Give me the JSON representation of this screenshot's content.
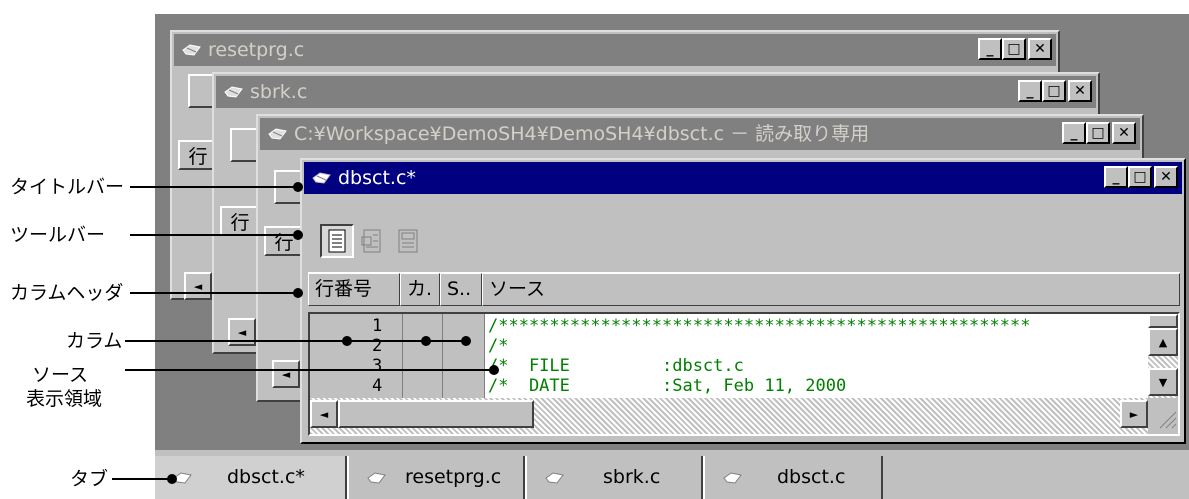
{
  "windows": {
    "resetprg": {
      "title": "resetprg.c"
    },
    "sbrk": {
      "title": "sbrk.c"
    },
    "dbsct_ro": {
      "title": "C:¥Workspace¥DemoSH4¥DemoSH4¥dbsct.c － 読み取り専用"
    },
    "dbsct_active": {
      "title": "dbsct.c*"
    },
    "back_col_label": "行",
    "min_glyph": "_",
    "max_glyph": "□",
    "close_glyph": "✕"
  },
  "columns": {
    "headers": [
      "行番号",
      "カ.",
      "S..",
      "ソース"
    ]
  },
  "source": {
    "line_numbers": [
      "1",
      "2",
      "3",
      "4"
    ],
    "code_lines": [
      "/****************************************************",
      "/*",
      "/*  FILE         :dbsct.c",
      "/*  DATE         :Sat, Feb 11, 2000"
    ]
  },
  "scroll": {
    "up": "▲",
    "down": "▼",
    "left": "◄",
    "right": "►"
  },
  "annotations": {
    "title_bar": "タイトルバー",
    "toolbar": "ツールバー",
    "column_header": "カラムヘッダ",
    "column": "カラム",
    "source_display_line1": "ソース",
    "source_display_line2": "表示領域",
    "tab": "タブ"
  },
  "tabs": [
    {
      "label": "dbsct.c*",
      "active": true
    },
    {
      "label": "resetprg.c",
      "active": false
    },
    {
      "label": "sbrk.c",
      "active": false
    },
    {
      "label": "dbsct.c",
      "active": false
    }
  ],
  "colors": {
    "active_title": "#000080",
    "inactive_title": "#808080",
    "code_green": "#008000",
    "face": "#c0c0c0"
  }
}
